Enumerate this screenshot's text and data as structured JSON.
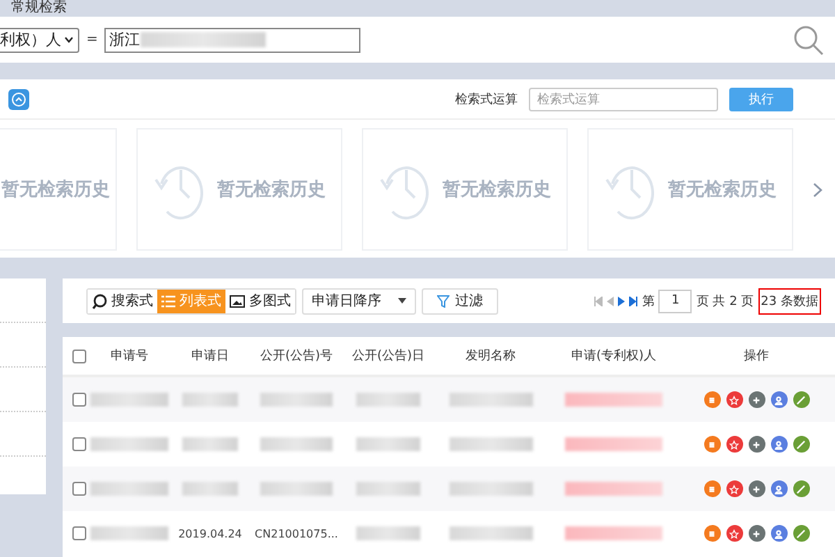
{
  "header": {
    "title": "常规检索"
  },
  "query": {
    "field": "利权）人",
    "operator": "=",
    "value": "浙江"
  },
  "expression": {
    "label": "检索式运算",
    "placeholder": "检索式运算",
    "button": "执行"
  },
  "history": [
    "暂无检索历史",
    "暂无检索历史",
    "暂无检索历史",
    "暂无检索历史"
  ],
  "toolbar": {
    "views": [
      {
        "label": "搜索式",
        "selected": false
      },
      {
        "label": "列表式",
        "selected": true
      },
      {
        "label": "多图式",
        "selected": false
      }
    ],
    "sort": "申请日降序",
    "filter": "过滤"
  },
  "pager": {
    "prefix": "第",
    "page": "1",
    "total": "页 共 2 页",
    "count": "23 条数据",
    "count_highlighted": true
  },
  "table": {
    "select_all_checked": false,
    "columns": [
      "申请号",
      "申请日",
      "公开(公告)号",
      "公开(公告)日",
      "发明名称",
      "申请(专利权)人",
      "操作"
    ],
    "rows": [
      {
        "checked": false,
        "cells": [
          null,
          null,
          null,
          null,
          null,
          null
        ]
      },
      {
        "checked": false,
        "cells": [
          null,
          null,
          null,
          null,
          null,
          null
        ]
      },
      {
        "checked": false,
        "cells": [
          null,
          null,
          null,
          null,
          null,
          null
        ]
      },
      {
        "checked": false,
        "cells": [
          null,
          "2019.04.24",
          "CN21001075...",
          null,
          null,
          null
        ]
      }
    ]
  }
}
